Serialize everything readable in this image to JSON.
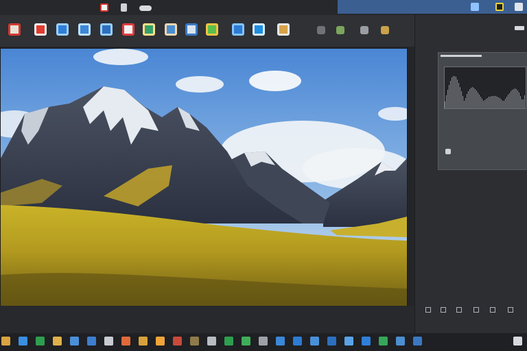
{
  "titlebar": {
    "accent_color": "#3c5f92",
    "accent_text": ""
  },
  "toolbar": {
    "tools": [
      {
        "icon": "image-icon",
        "color": "#e9e2d6",
        "accent": "#d23a2f"
      },
      {
        "icon": "crop-icon",
        "color": "#e33b2f",
        "accent": "#f3f3f3"
      },
      {
        "icon": "document-icon",
        "color": "#2f7fd9",
        "accent": "#9fd0ff"
      },
      {
        "icon": "layers-icon",
        "color": "#3b88d8",
        "accent": "#bfe2ff"
      },
      {
        "icon": "window-icon",
        "color": "#2c6fbf",
        "accent": "#9ad0ff"
      },
      {
        "icon": "pdf-icon",
        "color": "#f2f2f2",
        "accent": "#e23b3b"
      },
      {
        "icon": "photo-icon",
        "color": "#35a06a",
        "accent": "#ffe08a"
      },
      {
        "icon": "portrait-icon",
        "color": "#4b8fd1",
        "accent": "#f2d7b0"
      },
      {
        "icon": "archive-icon",
        "color": "#d9e4ef",
        "accent": "#3a78c2"
      },
      {
        "icon": "gallery-icon",
        "color": "#5cbf4b",
        "accent": "#f5c542"
      },
      {
        "icon": "folder-icon",
        "color": "#2d7bd3",
        "accent": "#85c4ff"
      },
      {
        "icon": "export-icon",
        "color": "#1f8fe0",
        "accent": "#d6efff"
      },
      {
        "icon": "brush-icon",
        "color": "#d8a24a",
        "accent": "#e8e8e8"
      }
    ]
  },
  "statusbar": {
    "zoom": ""
  },
  "colors": {
    "accent": "#3c5f92",
    "panel": "#45484d",
    "background": "#2b2d30"
  }
}
